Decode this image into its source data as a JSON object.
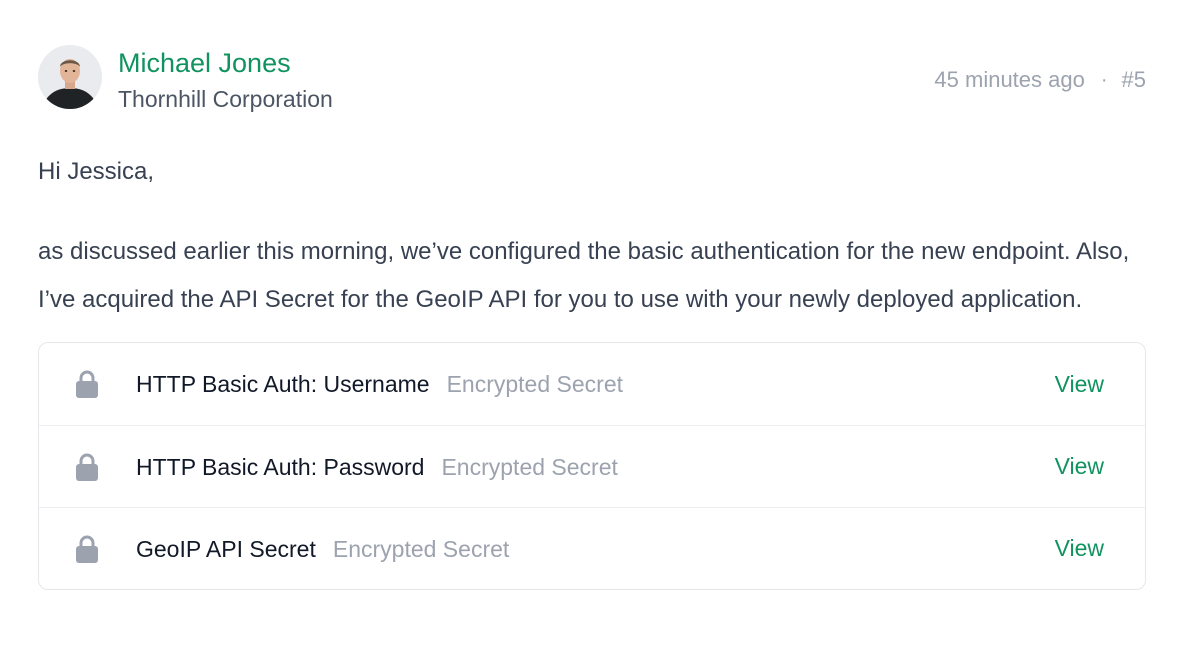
{
  "message": {
    "author": {
      "name": "Michael Jones",
      "organization": "Thornhill Corporation",
      "avatar_icon": "user-avatar"
    },
    "meta": {
      "time": "45 minutes ago",
      "separator": "·",
      "number": "#5"
    },
    "body": {
      "greeting": "Hi Jessica,",
      "paragraph": "as discussed earlier this morning, we’ve configured the basic authentication for the new endpoint. Also, I’ve acquired the API Secret for the GeoIP API for you to use with your newly deployed application."
    },
    "secrets": [
      {
        "label": "HTTP Basic Auth: Username",
        "sublabel": "Encrypted Secret",
        "action": "View",
        "icon": "lock-icon"
      },
      {
        "label": "HTTP Basic Auth: Password",
        "sublabel": "Encrypted Secret",
        "action": "View",
        "icon": "lock-icon"
      },
      {
        "label": "GeoIP API Secret",
        "sublabel": "Encrypted Secret",
        "action": "View",
        "icon": "lock-icon"
      }
    ]
  },
  "colors": {
    "accent": "#11935f",
    "muted": "#9ca3af",
    "text": "#374151",
    "border": "#e5e7eb",
    "lock": "#9ca3af"
  }
}
